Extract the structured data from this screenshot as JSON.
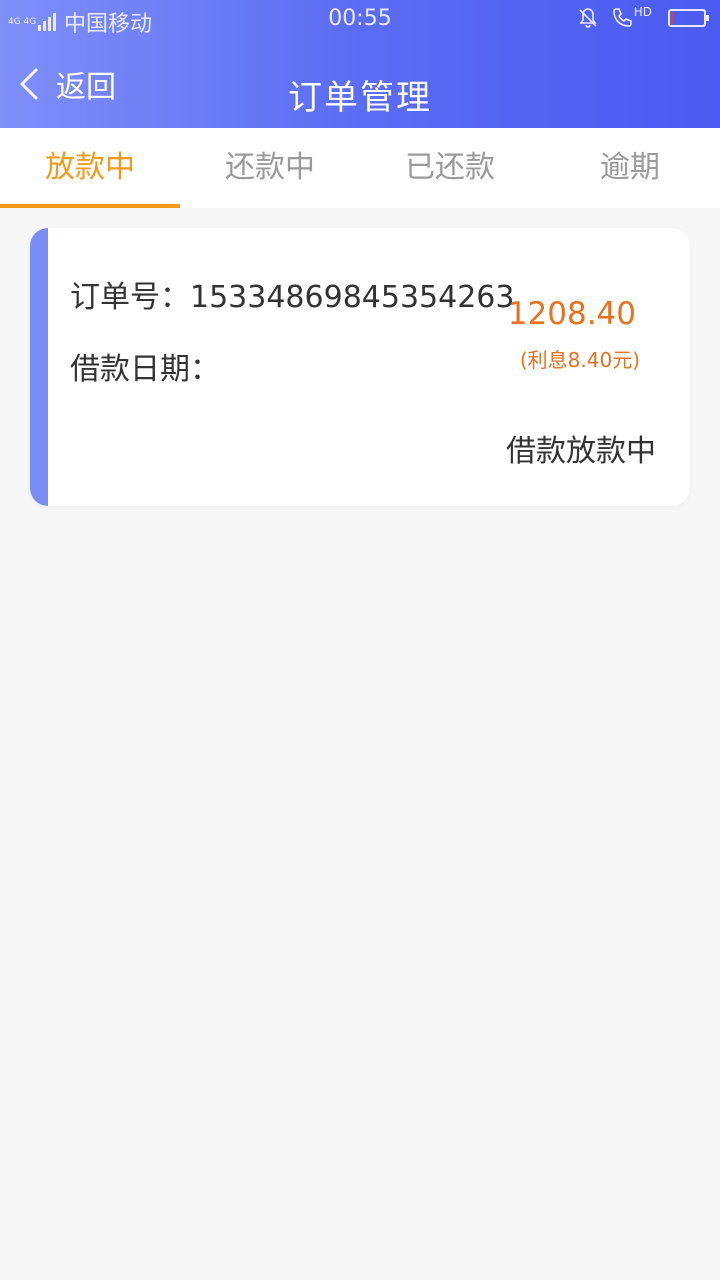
{
  "status_bar": {
    "network": "4G 4G",
    "carrier": "中国移动",
    "time": "00:55",
    "hd_label": "HD",
    "battery_level": 0.05,
    "icons": [
      "signal-icon",
      "bell-muted-icon",
      "phone-hd-icon",
      "battery-icon"
    ]
  },
  "nav": {
    "back_label": "返回",
    "title": "订单管理"
  },
  "tabs": [
    {
      "label": "放款中"
    },
    {
      "label": "还款中"
    },
    {
      "label": "已还款"
    },
    {
      "label": "逾期"
    }
  ],
  "active_tab": 0,
  "order": {
    "number_label": "订单号：",
    "number": "15334869845354263",
    "date_label": "借款日期：",
    "date": "",
    "amount": "1208.40",
    "interest": "(利息8.40元)",
    "status": "借款放款中"
  },
  "colors": {
    "header_start": "#7f8ff8",
    "header_end": "#4b5bf1",
    "active_tab": "#f39a1b",
    "amount": "#e8711e",
    "card_accent": "#7a8cf8"
  }
}
